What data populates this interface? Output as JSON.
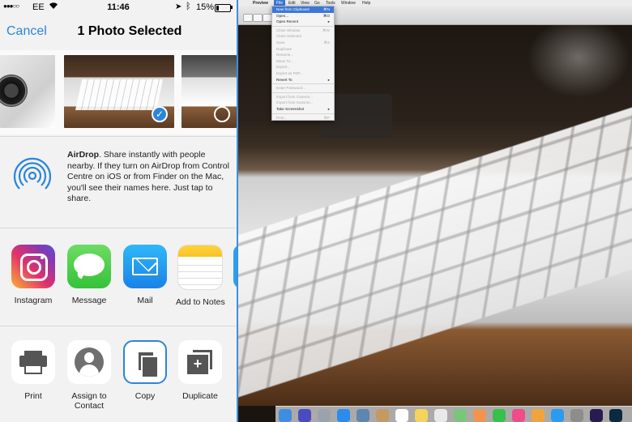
{
  "status_bar": {
    "signal": "●●●○○",
    "carrier": "EE",
    "time": "11:46",
    "battery": "15%"
  },
  "share_sheet": {
    "cancel_label": "Cancel",
    "title": "1 Photo Selected",
    "airdrop": {
      "title": "AirDrop",
      "description": ". Share instantly with people nearby. If they turn on AirDrop from Control Centre on iOS or from Finder on the Mac, you'll see their names here. Just tap to share."
    },
    "apps": [
      {
        "label": "Instagram",
        "icon": "instagram-icon"
      },
      {
        "label": "Message",
        "icon": "messages-icon"
      },
      {
        "label": "Mail",
        "icon": "mail-icon"
      },
      {
        "label": "Add to Notes",
        "icon": "notes-icon"
      }
    ],
    "actions": [
      {
        "label": "Print",
        "icon": "printer-icon"
      },
      {
        "label": "Assign to Contact",
        "icon": "contact-icon"
      },
      {
        "label": "Copy",
        "icon": "copy-icon",
        "selected": true
      },
      {
        "label": "Duplicate",
        "icon": "duplicate-icon"
      }
    ],
    "colors": {
      "accent": "#2a86d9"
    }
  },
  "mac": {
    "menubar": {
      "apple": "",
      "app": "Preview",
      "file": "File",
      "edit": "Edit",
      "view": "View",
      "go": "Go",
      "tools": "Tools",
      "window": "Window",
      "help": "Help"
    },
    "file_menu": {
      "new_from_clipboard": "New from Clipboard",
      "new_from_clipboard_sc": "⌘N",
      "open": "Open...",
      "open_sc": "⌘O",
      "open_recent": "Open Recent",
      "close_window": "Close Window",
      "close_window_sc": "⌘W",
      "close_selected": "Close Selected",
      "save": "Save",
      "save_sc": "⌘S",
      "duplicate": "Duplicate",
      "rename": "Rename...",
      "move_to": "Move To...",
      "export": "Export...",
      "export_pdf": "Export as PDF...",
      "revert_to": "Revert To",
      "enter_password": "Enter Password...",
      "import_camera": "Import from Camera...",
      "import_scanner": "Import from Scanner...",
      "take_screenshot": "Take Screenshot",
      "print": "Print...",
      "print_sc": "⌘P"
    }
  }
}
